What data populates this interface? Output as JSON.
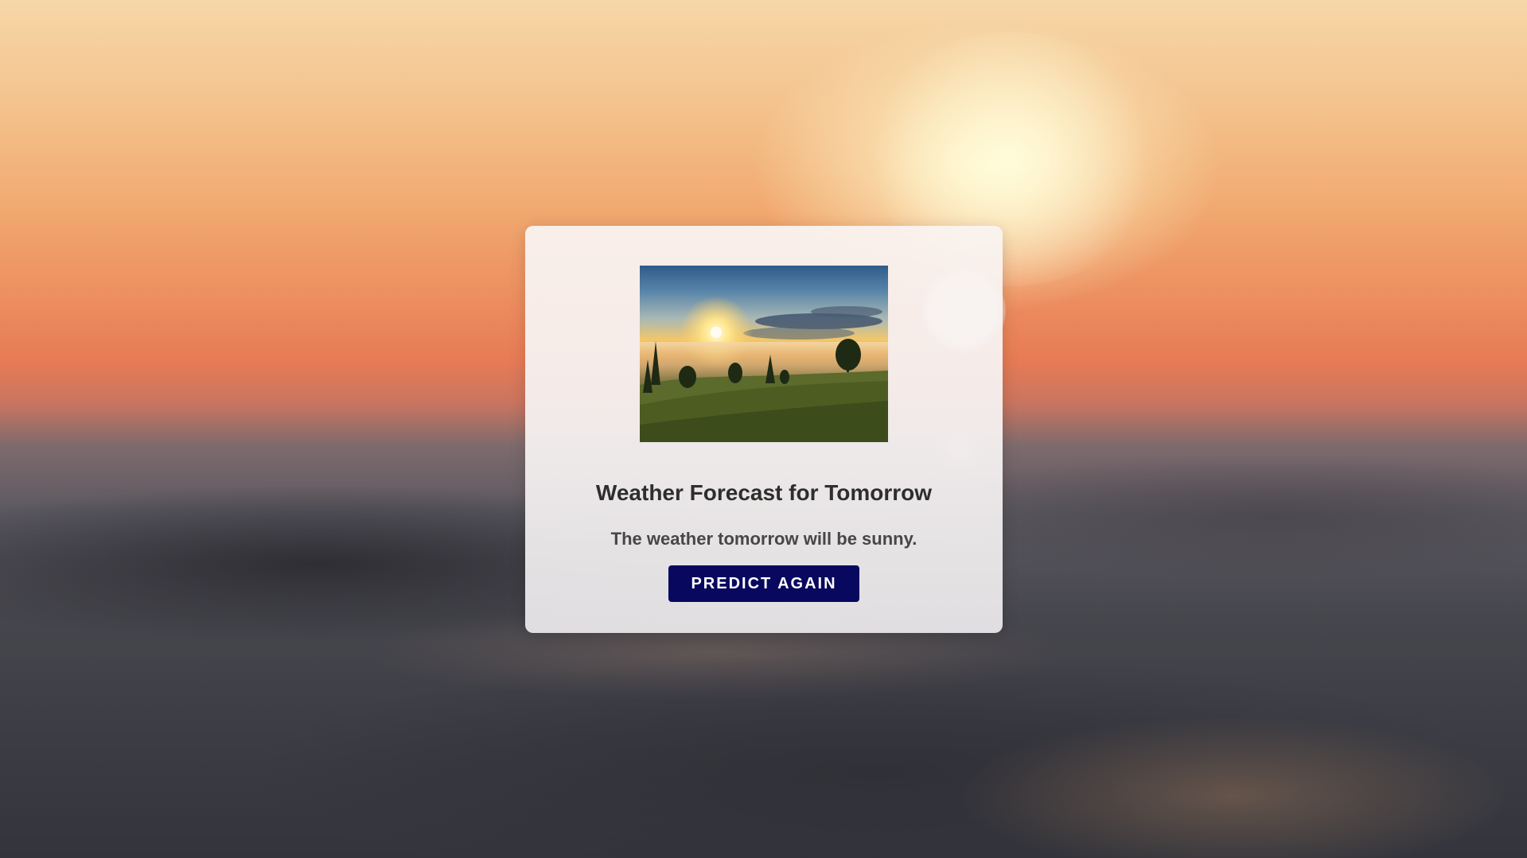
{
  "card": {
    "title": "Weather Forecast for Tomorrow",
    "message": "The weather tomorrow will be sunny.",
    "button_label": "PREDICT AGAIN"
  },
  "colors": {
    "button_background": "#07085e",
    "button_text": "#ffffff",
    "title_text": "#2e2e2e",
    "message_text": "#474747",
    "card_background": "#f4f0f0"
  },
  "images": {
    "background": "sunset-over-ocean-waves",
    "forecast_photo": "sunrise-over-misty-meadow"
  }
}
